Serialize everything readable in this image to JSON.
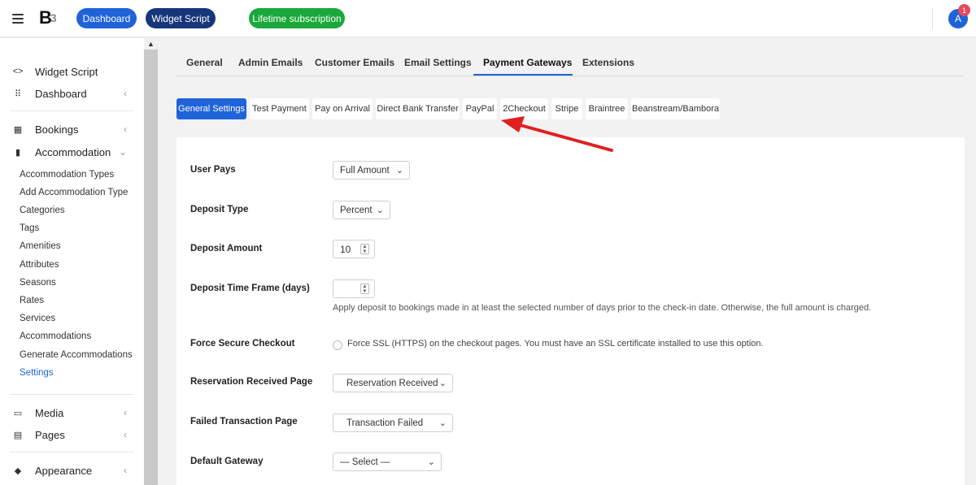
{
  "topbar": {
    "logo_text": "B",
    "logo_sub": "3",
    "dashboard_label": "Dashboard",
    "widget_label": "Widget Script",
    "lifetime_label": "Lifetime subscription",
    "avatar_letter": "A",
    "badge_count": "1"
  },
  "sidebar": {
    "widget_script": "Widget Script",
    "dashboard": "Dashboard",
    "bookings": "Bookings",
    "accommodation": "Accommodation",
    "sub_items": [
      "Accommodation Types",
      "Add Accommodation Type",
      "Categories",
      "Tags",
      "Amenities",
      "Attributes",
      "Seasons",
      "Rates",
      "Services",
      "Accommodations",
      "Generate Accommodations",
      "Settings"
    ],
    "media": "Media",
    "pages": "Pages",
    "appearance": "Appearance"
  },
  "tabs": [
    "General",
    "Admin Emails",
    "Customer Emails",
    "Email Settings",
    "Payment Gateways",
    "Extensions"
  ],
  "subtabs": [
    "General Settings",
    "Test Payment",
    "Pay on Arrival",
    "Direct Bank Transfer",
    "PayPal",
    "2Checkout",
    "Stripe",
    "Braintree",
    "Beanstream/Bambora"
  ],
  "form": {
    "user_pays_label": "User Pays",
    "user_pays_value": "Full Amount",
    "deposit_type_label": "Deposit Type",
    "deposit_type_value": "Percent",
    "deposit_amount_label": "Deposit Amount",
    "deposit_amount_value": "10",
    "deposit_time_label": "Deposit Time Frame (days)",
    "deposit_time_value": "",
    "deposit_time_help": "Apply deposit to bookings made in at least the selected number of days prior to the check-in date. Otherwise, the full amount is charged.",
    "force_secure_label": "Force Secure Checkout",
    "force_secure_text": "Force SSL (HTTPS) on the checkout pages. You must have an SSL certificate installed to use this option.",
    "reservation_page_label": "Reservation Received Page",
    "reservation_page_value": "Reservation Received",
    "failed_page_label": "Failed Transaction Page",
    "failed_page_value": "Transaction Failed",
    "default_gateway_label": "Default Gateway",
    "default_gateway_value": "— Select —"
  },
  "colors": {
    "accent": "#1f63d9",
    "navy": "#17357a",
    "green": "#1aa83a",
    "arrow": "#e02020"
  }
}
